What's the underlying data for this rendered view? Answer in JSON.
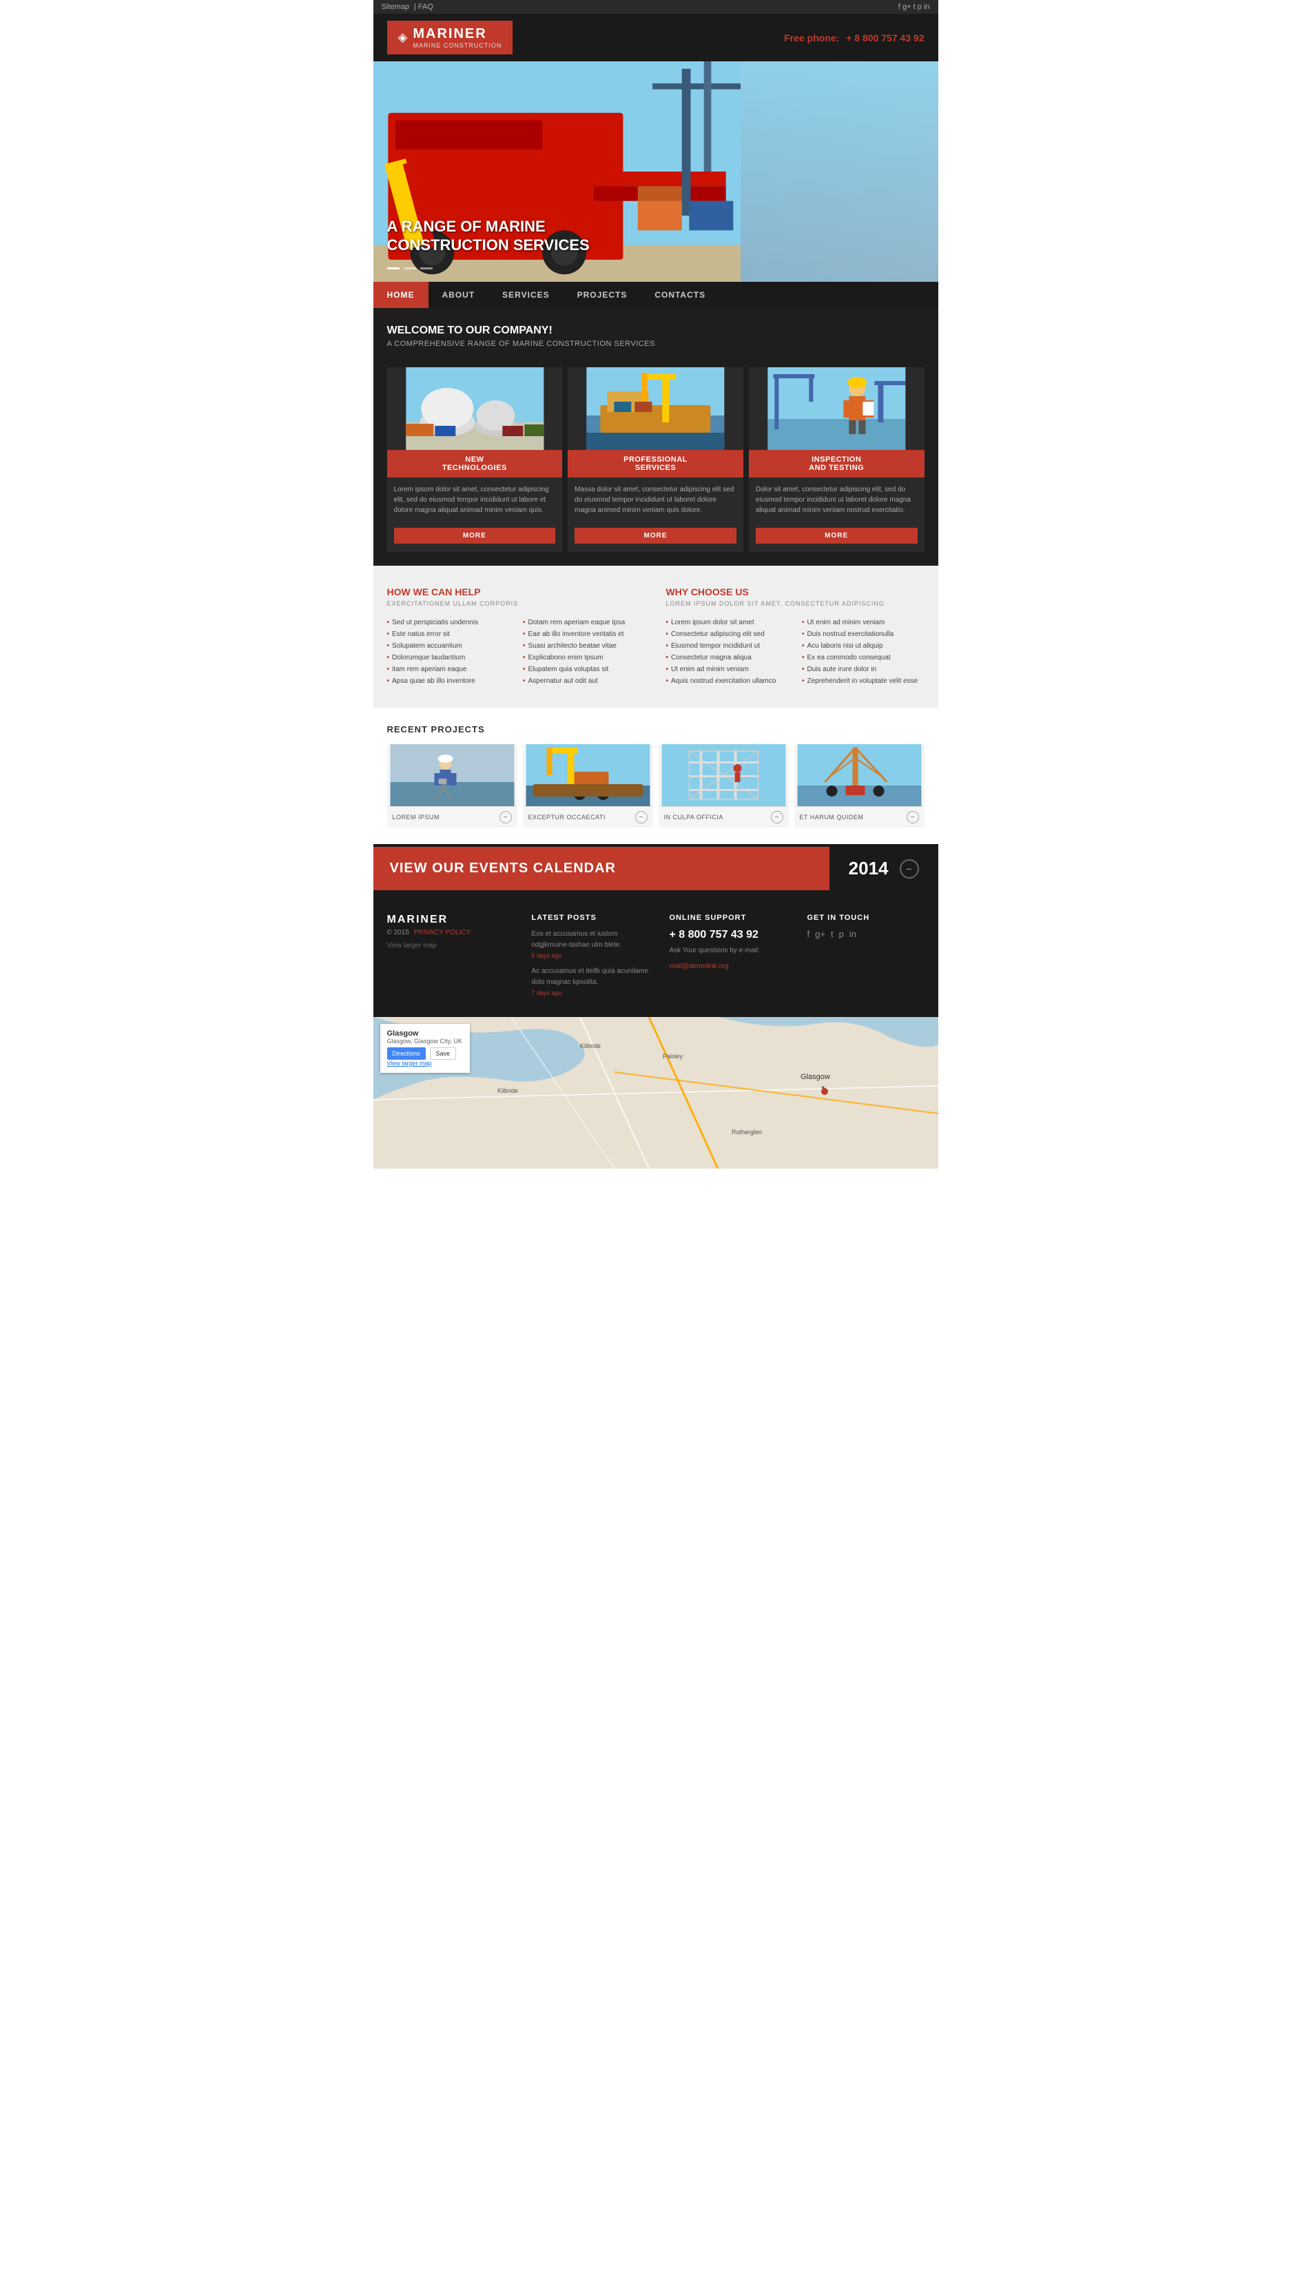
{
  "topbar": {
    "sitemap": "Sitemap",
    "faq": "FAQ"
  },
  "header": {
    "logo_icon": "◈",
    "logo_title": "MARINER",
    "logo_sub": "MARINE CONSTRUCTION",
    "phone_label": "Free phone:",
    "phone_number": "+ 8 800 757 43 92"
  },
  "hero": {
    "headline_line1": "A RANGE OF MARINE",
    "headline_line2": "CONSTRUCTION SERVICES"
  },
  "nav": {
    "items": [
      {
        "label": "HOME",
        "active": true
      },
      {
        "label": "ABOUT",
        "active": false
      },
      {
        "label": "SERVICES",
        "active": false
      },
      {
        "label": "PROJECTS",
        "active": false
      },
      {
        "label": "CONTACTS",
        "active": false
      }
    ]
  },
  "welcome": {
    "title": "WELCOME TO OUR COMPANY!",
    "subtitle": "A COMPREHENSIVE RANGE OF MARINE CONSTRUCTION SERVICES"
  },
  "cards": [
    {
      "label": "NEW\nTECHNOLOGIES",
      "text": "Lorem ipsum dolor sit amet, consectetur adipiscing elit, sed do eiusmod tempor incididunt ut labore et dolore magna aliquat animad minim veniam quis.",
      "btn": "MORE",
      "color_top": "#87CEEB",
      "color_bot": "#6b9fb3"
    },
    {
      "label": "PROFESSIONAL\nSERVICES",
      "text": "Massa dolor sit amet, consectetur adipiscing elit sed do eiusmod tempor incididunt ut laboret dolore magna animed minim veniam quis dolore.",
      "btn": "MORE",
      "color_top": "#f0c040",
      "color_bot": "#c09020"
    },
    {
      "label": "INSPECTION\nAND TESTING",
      "text": "Dolor sit amet, consectetur adipiscing elit, sed do eiusmod tempor incididunt ut laboret dolore magna aliquat animad minim veniam nostrud exercitatio.",
      "btn": "MORE",
      "color_top": "#d4a060",
      "color_bot": "#a07040"
    }
  ],
  "how_we_help": {
    "title": "HOW WE CAN HELP",
    "subtitle": "EXERCITATIONEM ULLAM CORPORIS",
    "list1": [
      "Sed ut perspiciatis undennis",
      "Este natus error sit",
      "Solupatem accuantium",
      "Dolorumque laudantium",
      "itam rem aperiam eaque",
      "Apsa quae ab illo inventore"
    ],
    "list2": [
      "Dotam rem aperiam eaque Ipsa",
      "Eae ab illo inventore veritatis et",
      "Suasi architecto beatae vitae",
      "Explicabono enim Ipsum",
      "Elupatem quia voluptas sit",
      "Aspernatur aut odit aut"
    ]
  },
  "why_choose_us": {
    "title": "WHY CHOOSE US",
    "subtitle": "LOREM IPSUM DOLOR SIT AMET, CONSECTETUR ADIPISCING",
    "list1": [
      "Lorem ipsum dolor sit amet",
      "Consectetur adipiscing elit sed",
      "Eiusmod tempor incididunt ut",
      "Consectetur magna aliqua",
      "Ut enim ad minim veniam",
      "Aquis nostrud exercitation ullamco"
    ],
    "list2": [
      "Ut enim ad minim veniam",
      "Duis nostrud exercitationulla",
      "Acu laboris nisi ut aliquip",
      "Ex ea commodo consequat",
      "Duis aute irure dolor in",
      "Zeprehenderit in voluptate velit esse"
    ]
  },
  "recent_projects": {
    "title": "RECENT PROJECTS",
    "items": [
      {
        "label": "LOREM IPSUM",
        "color1": "#b0c8d8",
        "color2": "#6090a8"
      },
      {
        "label": "EXCEPTUR OCCAECATI",
        "color1": "#f0c840",
        "color2": "#c08820"
      },
      {
        "label": "IN CULPA OFFICIA",
        "color1": "#d0d8e8",
        "color2": "#8098b8"
      },
      {
        "label": "ET HARUM QUIDEM",
        "color1": "#d0a870",
        "color2": "#c08050"
      }
    ]
  },
  "events": {
    "label": "VIEW OUR EVENTS CALENDAR",
    "year": "2014",
    "icon": "−"
  },
  "footer": {
    "brand": "MARINER",
    "year": "© 2015",
    "privacy": "PRIVACY POLICY",
    "map_link": "View larger map",
    "latest_posts": {
      "title": "LATEST POSTS",
      "posts": [
        {
          "text": "Eos et accusamus et iustom odgjkmuine-tashao ulm blete.",
          "date": "5 days ago"
        },
        {
          "text": "Ac accusamus et itellb quia acunilame dolo magnac kpsolita.",
          "date": "7 days ago"
        }
      ]
    },
    "online_support": {
      "title": "ONLINE SUPPORT",
      "phone": "+ 8 800 757 43 92",
      "ask_text": "Ask Your questions by e-mail:",
      "email": "mail@demolink.org"
    },
    "get_in_touch": {
      "title": "GET IN TOUCH",
      "social_icons": [
        "f",
        "g+",
        "t",
        "p",
        "in"
      ]
    }
  },
  "map": {
    "place_name": "Glasgow",
    "place_detail": "Glasgow, Glasgow City, UK",
    "directions_btn": "Directions",
    "save_btn": "Save",
    "link": "View larger map"
  },
  "social_icons": [
    "f",
    "g+",
    "t",
    "p",
    "in"
  ]
}
